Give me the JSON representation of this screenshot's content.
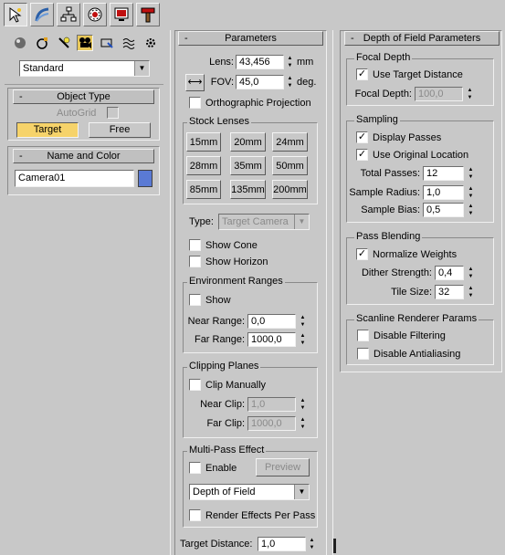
{
  "toolbar": {
    "tabs": [
      {
        "icon": "create-cursor-icon"
      },
      {
        "icon": "modify-curve-icon"
      },
      {
        "icon": "hierarchy-icon"
      },
      {
        "icon": "motion-icon"
      },
      {
        "icon": "display-icon"
      },
      {
        "icon": "utilities-hammer-icon"
      }
    ]
  },
  "create": {
    "category_icons": [
      "geometry-sphere-icon",
      "shapes-icon",
      "lights-icon",
      "cameras-icon",
      "helpers-icon",
      "spacewarps-icon",
      "systems-icon"
    ],
    "dropdown_value": "Standard",
    "object_type": {
      "title": "Object Type",
      "autogrid_label": "AutoGrid",
      "target_label": "Target",
      "free_label": "Free"
    },
    "name_color": {
      "title": "Name and Color",
      "name_value": "Camera01",
      "swatch_color": "#5a7ad4"
    }
  },
  "parameters": {
    "title": "Parameters",
    "lens_label": "Lens:",
    "lens_value": "43,456",
    "lens_unit": "mm",
    "fov_label": "FOV:",
    "fov_value": "45,0",
    "fov_unit": "deg.",
    "ortho_label": "Orthographic Projection",
    "stock_lenses": {
      "title": "Stock Lenses",
      "buttons": [
        "15mm",
        "20mm",
        "24mm",
        "28mm",
        "35mm",
        "50mm",
        "85mm",
        "135mm",
        "200mm"
      ]
    },
    "type_label": "Type:",
    "type_value": "Target Camera",
    "show_cone": "Show Cone",
    "show_horizon": "Show Horizon",
    "env_ranges": {
      "title": "Environment Ranges",
      "show_label": "Show",
      "near_label": "Near Range:",
      "near_value": "0,0",
      "far_label": "Far Range:",
      "far_value": "1000,0"
    },
    "clipping": {
      "title": "Clipping Planes",
      "clip_manually": "Clip Manually",
      "near_label": "Near Clip:",
      "near_value": "1,0",
      "far_label": "Far Clip:",
      "far_value": "1000,0"
    },
    "multipass": {
      "title": "Multi-Pass Effect",
      "enable_label": "Enable",
      "preview_label": "Preview",
      "effect_value": "Depth of Field",
      "render_effects": "Render Effects Per Pass"
    },
    "target_distance_label": "Target Distance:",
    "target_distance_value": "1,0"
  },
  "dof": {
    "title": "Depth of Field Parameters",
    "focal": {
      "title": "Focal Depth",
      "use_target": "Use Target Distance",
      "depth_label": "Focal Depth:",
      "depth_value": "100,0"
    },
    "sampling": {
      "title": "Sampling",
      "display_passes": "Display Passes",
      "use_original": "Use Original Location",
      "total_label": "Total Passes:",
      "total_value": "12",
      "radius_label": "Sample Radius:",
      "radius_value": "1,0",
      "bias_label": "Sample Bias:",
      "bias_value": "0,5"
    },
    "blending": {
      "title": "Pass Blending",
      "normalize": "Normalize Weights",
      "dither_label": "Dither Strength:",
      "dither_value": "0,4",
      "tile_label": "Tile Size:",
      "tile_value": "32"
    },
    "scanline": {
      "title": "Scanline Renderer Params",
      "disable_filtering": "Disable Filtering",
      "disable_antialiasing": "Disable Antialiasing"
    }
  }
}
